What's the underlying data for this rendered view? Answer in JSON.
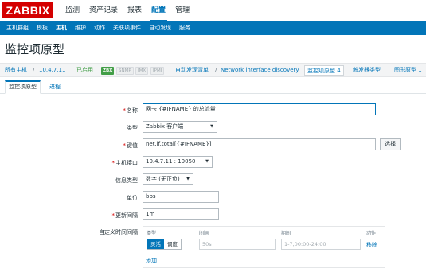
{
  "logo": "ZABBIX",
  "topnav": [
    "监测",
    "资产记录",
    "报表",
    "配置",
    "管理"
  ],
  "subnav": [
    "主机群组",
    "模板",
    "主机",
    "维护",
    "动作",
    "关联项事件",
    "自动发现",
    "服务"
  ],
  "page_title": "监控项原型",
  "breadcrumb": {
    "all_hosts": "所有主机",
    "sep": "/",
    "host": "10.4.7.11",
    "status": "已启用",
    "tags": [
      "ZBX",
      "SNMP",
      "JMX",
      "IPMI"
    ],
    "discovery_list": "自动发现清单",
    "discovery_rule": "Network interface discovery",
    "item_prototypes": "监控项原型 4",
    "trigger_prototypes": "触发器类型",
    "graph_prototypes": "图形原型 1"
  },
  "tabs": [
    "监控项原型",
    "进程"
  ],
  "form": {
    "name_label": "名称",
    "name_value": "网卡 {#IFNAME} 的总流量",
    "type_label": "类型",
    "type_value": "Zabbix 客户端",
    "key_label": "键值",
    "key_value": "net.if.total[{#IFNAME}]",
    "select_button": "选择",
    "interface_label": "主机接口",
    "interface_value": "10.4.7.11 : 10050",
    "info_type_label": "信息类型",
    "info_type_value": "数字 (无正负)",
    "units_label": "单位",
    "units_value": "bps",
    "interval_label": "更新间隔",
    "interval_value": "1m",
    "custom_label": "自定义时间间隔",
    "custom": {
      "col_type": "类型",
      "col_interval": "间隔",
      "col_period": "期间",
      "col_action": "动作",
      "flexible": "灵活",
      "scheduling": "调度",
      "interval_placeholder": "50s",
      "period_placeholder": "1-7,00:00-24:00",
      "remove": "移除",
      "add": "添加"
    }
  },
  "colors": {
    "brand": "#d40000",
    "accent": "#0275b8",
    "enabled": "#429e47"
  }
}
